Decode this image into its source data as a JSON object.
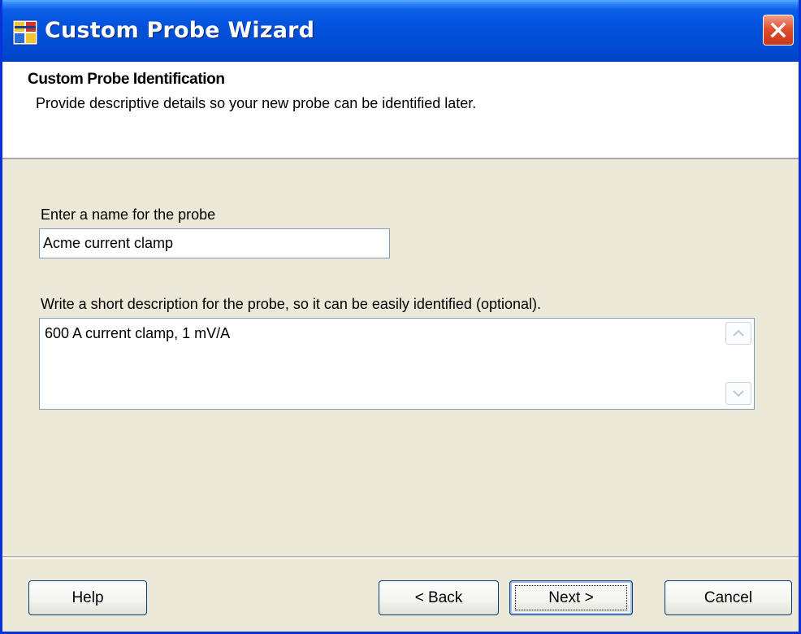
{
  "window": {
    "title": "Custom Probe Wizard"
  },
  "header": {
    "title": "Custom Probe Identification",
    "subtitle": "Provide descriptive details so your new probe can be identified later."
  },
  "form": {
    "name_label": "Enter a name for the probe",
    "name_value": "Acme current clamp",
    "description_label": "Write a short description for the probe, so it can be easily identified (optional).",
    "description_value": "600 A current clamp, 1 mV/A"
  },
  "buttons": {
    "help": "Help",
    "back": "< Back",
    "next": "Next >",
    "cancel": "Cancel"
  },
  "colors": {
    "titlebar": "#0353dc",
    "close": "#e0502e",
    "background": "#ece9d8"
  },
  "icons": {
    "app": "wizard-app-icon",
    "close": "close-icon",
    "scroll_up": "scroll-up-icon",
    "scroll_down": "scroll-down-icon"
  }
}
